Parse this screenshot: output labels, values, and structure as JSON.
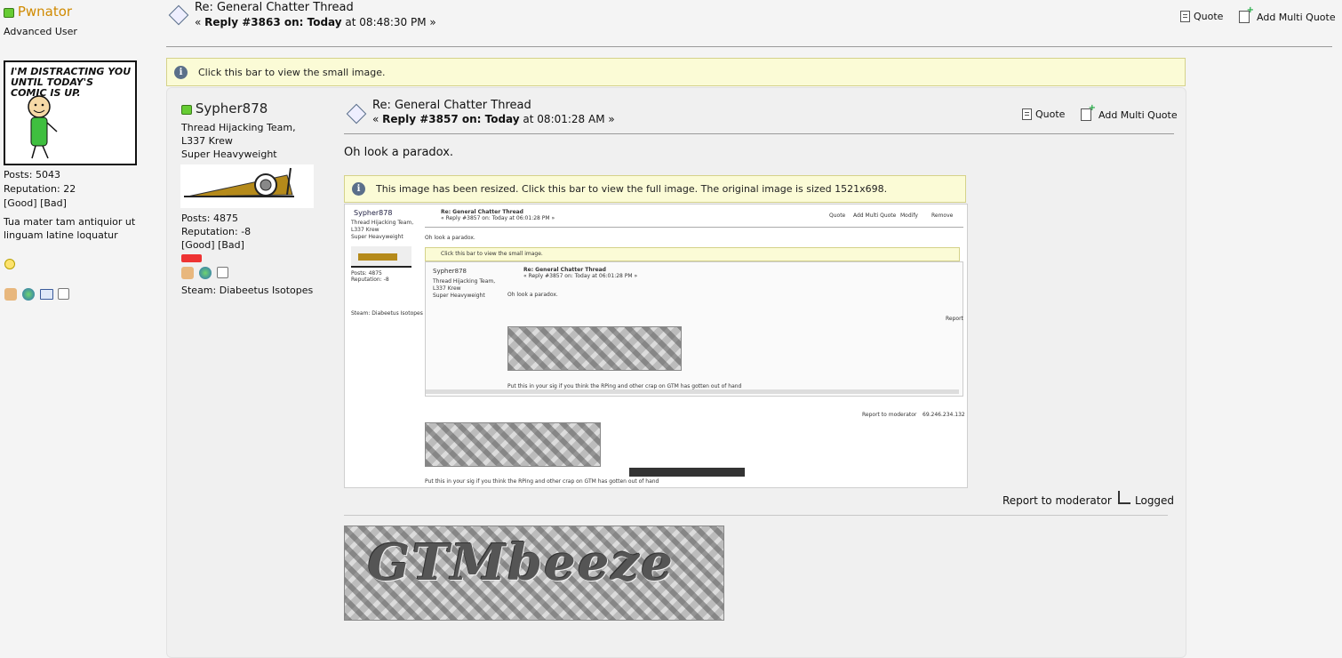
{
  "outer_post": {
    "author": {
      "name": "Pwnator",
      "rank": "Advanced User",
      "avatar_caption": "I'M DISTRACTING YOU UNTIL TODAY'S COMIC IS UP.",
      "posts": "Posts: 5043",
      "reputation": "Reputation: 22",
      "good": "[Good]",
      "bad": "[Bad]",
      "personal_text": "Tua mater tam antiquior ut linguam latine loquatur"
    },
    "title": "Re: General Chatter Thread",
    "reply_prefix": "« ",
    "reply_bold": "Reply #3863 on: Today",
    "reply_time": " at 08:48:30 PM »",
    "quote": "Quote",
    "multi_quote": "Add Multi Quote",
    "notice": "Click this bar to view the small image."
  },
  "inner_post": {
    "author": {
      "name": "Sypher878",
      "group": "Thread Hijacking Team, L337 Krew",
      "rank": "Super Heavyweight",
      "posts": "Posts: 4875",
      "reputation": "Reputation: -8",
      "good": "[Good]",
      "bad": "[Bad]",
      "steam": "Steam: Diabeetus Isotopes"
    },
    "title": "Re: General Chatter Thread",
    "reply_prefix": "« ",
    "reply_bold": "Reply #3857 on: Today",
    "reply_time": " at 08:01:28 AM »",
    "quote": "Quote",
    "multi_quote": "Add Multi Quote",
    "body": "Oh look a paradox.",
    "notice": "This image has been resized. Click this bar to view the full image. The original image is sized 1521x698.",
    "report": "Report to moderator",
    "logged": "Logged"
  },
  "screenshot_thumb": {
    "name": "Sypher878",
    "group1": "Thread Hijacking Team,",
    "group2": "L337 Krew",
    "rank": "Super Heavyweight",
    "title": "Re: General Chatter Thread",
    "reply": "« Reply #3857 on: Today at 06:01:28 PM »",
    "quote": "Quote",
    "multi": "Add Multi Quote",
    "modify": "Modify",
    "remove": "Remove",
    "body": "Oh look a paradox.",
    "notice": "Click this bar to view the small image.",
    "posts": "Posts: 4875",
    "rep": "Reputation: -8",
    "steam": "Steam: Diabeetus Isotopes",
    "sig": "Put this in your sig if you think the RPing and other crap on GTM has gotten out of hand",
    "report": "Report to moderator",
    "ip": "69.246.234.132",
    "report_short": "Report"
  },
  "colors": {
    "username": "#d08a00",
    "notice_bg": "#fbfbd6",
    "online": "#66cc33"
  }
}
